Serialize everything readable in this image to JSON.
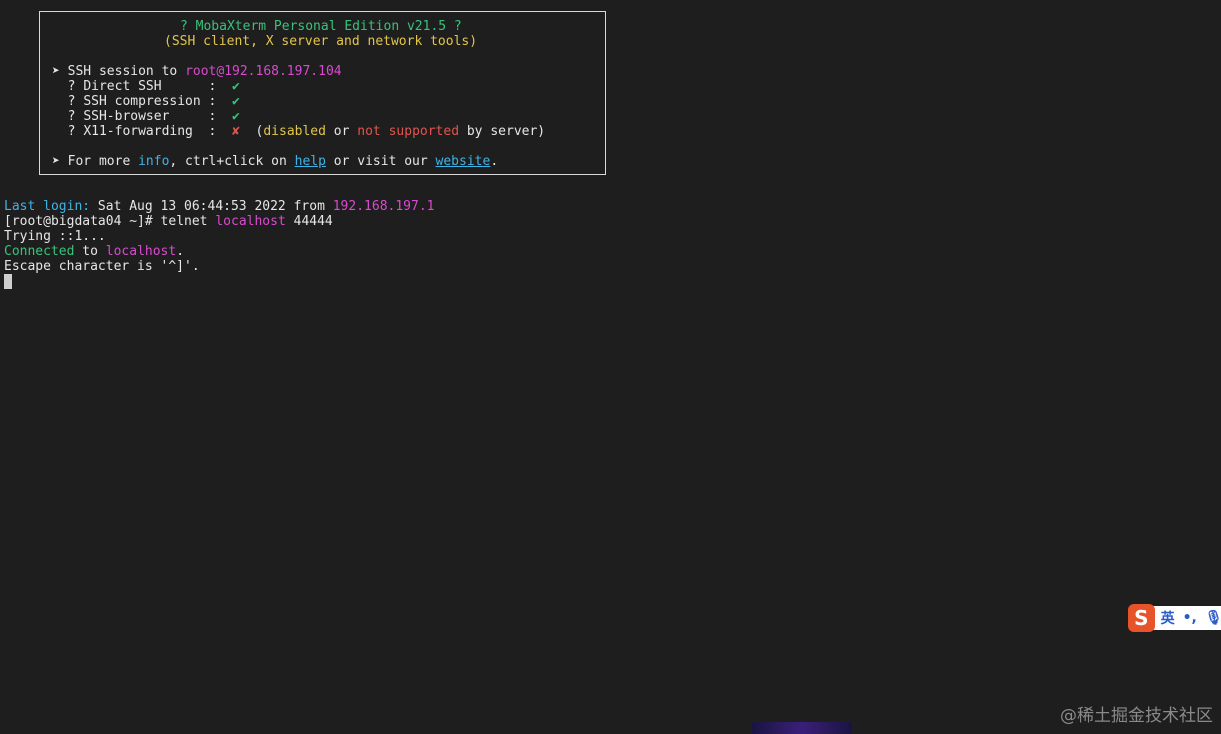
{
  "banner": {
    "title": "? MobaXterm Personal Edition v21.5 ?",
    "subtitle": "(SSH client, X server and network tools)",
    "session_prefix": "➤ SSH session to ",
    "session_target": "root@192.168.197.104",
    "features": [
      {
        "prefix": "  ? ",
        "name": "Direct SSH      ",
        "sep": ":  ",
        "mark": "✔"
      },
      {
        "prefix": "  ? ",
        "name": "SSH compression ",
        "sep": ":  ",
        "mark": "✔"
      },
      {
        "prefix": "  ? ",
        "name": "SSH-browser     ",
        "sep": ":  ",
        "mark": "✔"
      },
      {
        "prefix": "  ? ",
        "name": "X11-forwarding  ",
        "sep": ":  ",
        "mark": "✘"
      }
    ],
    "x11_note": {
      "open": "  (",
      "disabled": "disabled",
      "or": " or ",
      "not_supported": "not supported",
      "by_server": " by server)"
    },
    "info_line": {
      "prefix": "➤ For more ",
      "info": "info",
      "mid": ", ctrl+click on ",
      "help": "help",
      "visit": " or visit our ",
      "website": "website",
      "end": "."
    }
  },
  "terminal": {
    "last_login_label": "Last login:",
    "last_login_text": " Sat Aug 13 06:44:53 2022 from ",
    "last_login_ip": "192.168.197.1",
    "prompt": "[root@bigdata04 ~]# ",
    "cmd_telnet": "telnet ",
    "cmd_host": "localhost",
    "cmd_port": " 44444",
    "trying": "Trying ::1...",
    "connected": "Connected",
    "connected_to": " to ",
    "connected_host": "localhost",
    "connected_end": ".",
    "escape": "Escape character is '^]'."
  },
  "ime": {
    "logo": "S",
    "lang": "英",
    "punct": "•,",
    "mic": "🎙"
  },
  "watermark": "@稀土掘金技术社区",
  "colors": {
    "background": "#1e1e1e",
    "green": "#39c27c",
    "yellow": "#e3c54a",
    "magenta": "#d84ad0",
    "cyan": "#3fb3e6",
    "red": "#e0544f"
  }
}
